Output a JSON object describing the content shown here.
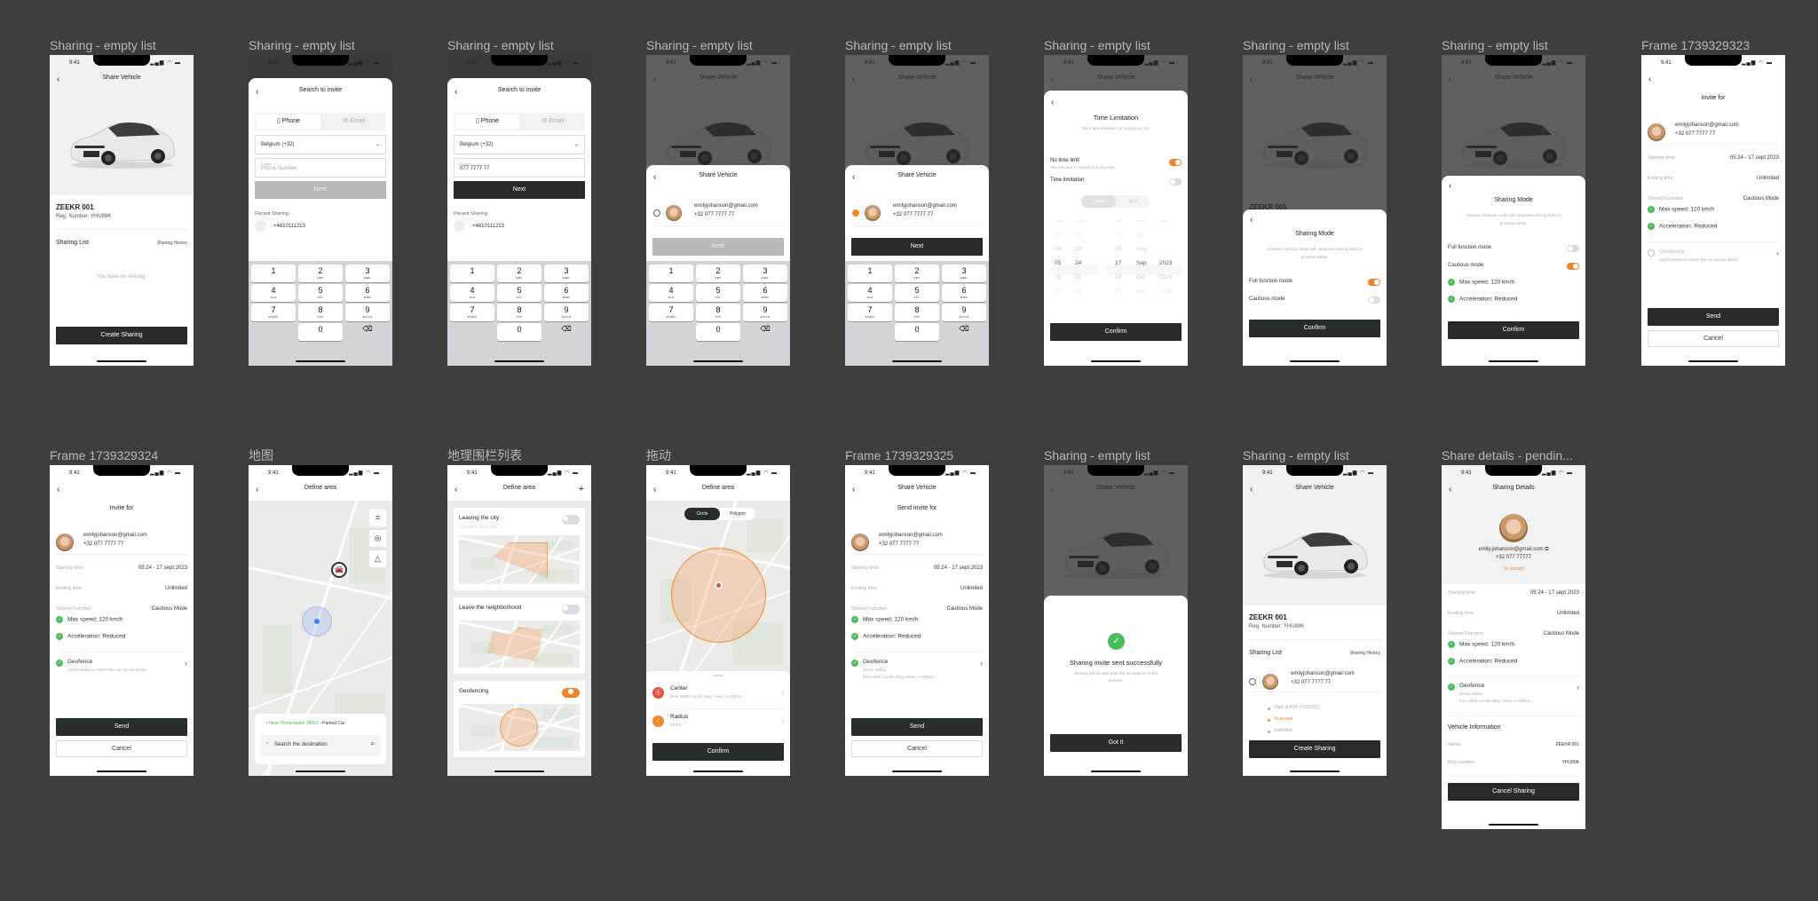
{
  "canvas": {
    "background": "#3e3e3e"
  },
  "colors": {
    "accent": "#f0822a",
    "dark_button": "#262b2c",
    "success": "#4cbb5a",
    "disabled_button": "#b7b8b8"
  },
  "status_bar": {
    "time": "9:41",
    "icons": "signal-wifi-battery"
  },
  "frames": [
    {
      "title": "Sharing - empty list",
      "header": "Share Vehicle",
      "vehicle_name": "ZEEKR 001",
      "reg_number": "Reg. Number: YHU89K",
      "section_title": "Sharing  List",
      "section_link": "Sharing History",
      "empty_text": "You have no sharing.",
      "button": "Create Sharing"
    },
    {
      "title": "Sharing - empty list",
      "header": "Search to invite",
      "tabs": [
        "Phone",
        "Email"
      ],
      "country": "Belgium (+32)",
      "phone_label": "Phone",
      "phone_placeholder": "Phone Number",
      "button": "Next",
      "recent_title": "Recent Sharing",
      "recent_item": "+4610111213"
    },
    {
      "title": "Sharing - empty list",
      "header": "Search to invite",
      "tabs": [
        "Phone",
        "Email"
      ],
      "country": "Belgium (+32)",
      "phone_label": "Phone",
      "phone_value": "077 7777 77",
      "button": "Next",
      "recent_title": "Recent Sharing",
      "recent_item": "+4610111213"
    },
    {
      "title": "Sharing - empty list",
      "background_header": "Share Vehicle",
      "header": "Share Vehicle",
      "email": "emilyjohanson@gmail.com",
      "phone": "+32 077 7777 77",
      "selected": false,
      "button": "Next"
    },
    {
      "title": "Sharing - empty list",
      "background_header": "Share Vehicle",
      "header": "Share Vehicle",
      "email": "emilyjohanson@gmail.com",
      "phone": "+32 077 7777 77",
      "selected": true,
      "button": "Next"
    },
    {
      "title": "Sharing - empty list",
      "background_header": "Share Vehicle",
      "header": "Time Limitation",
      "subtitle": "Set a time limitation for using your car.",
      "option1": "No time limit",
      "option1_sub": "You can end or change it at any time",
      "option1_on": true,
      "option2": "Time limitation",
      "option2_on": false,
      "seg": [
        "Start",
        "End"
      ],
      "picker_headers": [
        "Hours",
        "Minutes",
        "Days",
        "Months",
        "Years"
      ],
      "hours": [
        "03",
        "04",
        "05",
        "06",
        "07"
      ],
      "minutes": [
        "22",
        "23",
        "24",
        "25",
        "26"
      ],
      "days": [
        "15",
        "16",
        "17",
        "18",
        "19"
      ],
      "months": [
        "Jul",
        "Aug",
        "Sep",
        "Oct",
        "Nov"
      ],
      "years": [
        "",
        "",
        "2023",
        "2024",
        "2025"
      ],
      "button": "Confirm"
    },
    {
      "title": "Sharing - empty list",
      "background_header": "Share Vehicle",
      "background_vehicle": "ZEEKR 001",
      "header": "Sharing Mode",
      "subtitle": "Activate Cautious mode will customize driving limits to promote safety.",
      "mode1": "Full function mode",
      "mode1_on": true,
      "mode2": "Cautious mode",
      "mode2_on": false,
      "button": "Confirm"
    },
    {
      "title": "Sharing - empty list",
      "background_header": "Share Vehicle",
      "header": "Sharing Mode",
      "subtitle": "Activate Cautious mode will customize driving limits to promote safety.",
      "mode1": "Full function mode",
      "mode1_on": false,
      "mode2": "Cautious mode",
      "mode2_on": true,
      "features": [
        "Max speed: 120 km/h",
        "Acceleration: Reduced"
      ],
      "button": "Confirm"
    },
    {
      "title": "Frame 1739329323",
      "header": "Invite for",
      "email": "emilyjohanson@gmail.com",
      "phone": "+32 077 7777 77",
      "rows": [
        {
          "k": "Starting time",
          "v": "05:24 - 17 sept 2023"
        },
        {
          "k": "Ending time",
          "v": "Unlimited"
        },
        {
          "k": "Shared Function",
          "v": "Cautious Mode"
        }
      ],
      "features": [
        "Max speed: 120 km/h",
        "Acceleration: Reduced"
      ],
      "geofence": "Geofence",
      "geofence_sub": "Add limitation to where the car can be driven",
      "geofence_enabled": false,
      "send": "Send",
      "cancel": "Cancel"
    },
    {
      "title": "Frame 1739329324",
      "header": "Invite for",
      "email": "emilyjohanson@gmail.com",
      "phone": "+32 077 7777 77",
      "rows": [
        {
          "k": "Starting time",
          "v": "05:24 - 17 sept 2023"
        },
        {
          "k": "Ending time",
          "v": "Unlimited"
        },
        {
          "k": "Shared Function",
          "v": "Cautious Mode"
        }
      ],
      "features": [
        "Max speed: 120 km/h",
        "Acceleration: Reduced"
      ],
      "geofence": "Geofence",
      "geofence_sub": "Add limitation to where the car can be driven",
      "geofence_enabled": true,
      "send": "Send",
      "cancel": "Cancel"
    },
    {
      "title": "地图",
      "header": "Define area",
      "location_text": "Near Olympiapark 18052",
      "location_suffix": " - Parked Car",
      "search_placeholder": "Search the destination",
      "map_tools": [
        "grid-icon",
        "locate-icon",
        "navigate-icon"
      ]
    },
    {
      "title": "地理围栏列表",
      "header": "Define area",
      "areas": [
        {
          "name": "Leaving the city",
          "date": "27/08/2023 - 27/08/2023",
          "on": false,
          "shape": "polygon"
        },
        {
          "name": "Leave the neighborhood",
          "date": "",
          "on": false,
          "shape": "polygon"
        },
        {
          "name": "Geofencing",
          "date": "",
          "on": true,
          "shape": "circle"
        }
      ]
    },
    {
      "title": "拖动",
      "header": "Define area",
      "seg": [
        "Circle",
        "Polygon"
      ],
      "center_label": "Center",
      "center_value": "Near 3800 Lincoln Way, Ames, IA 50014...",
      "radius_label": "Radius",
      "radius_value": "10 km",
      "button": "Confirm"
    },
    {
      "title": "Frame 1739329325",
      "header": "Share Vehicle",
      "subheader": "Send invite for",
      "email": "emilyjohanson@gmail.com",
      "phone": "+32 077 7777 77",
      "rows": [
        {
          "k": "Starting time",
          "v": "05:24 - 17 sept 2023"
        },
        {
          "k": "Ending time",
          "v": "Unlimited"
        },
        {
          "k": "Shared Function",
          "v": "Cautious Mode"
        }
      ],
      "features": [
        "Max speed: 120 km/h",
        "Acceleration: Reduced"
      ],
      "geofence": "Geofence",
      "geofence_sub1": "10 km radius",
      "geofence_sub2": "from 3800 Lincoln Way, Ames, IA 50014...",
      "send": "Send",
      "cancel": "Cancel"
    },
    {
      "title": "Sharing - empty list",
      "background_header": "Share Vehicle",
      "success_title": "Sharing invite sent successfully",
      "success_sub": "Sharing will be valid after the acceptance of the receiver.",
      "button": "Got it"
    },
    {
      "title": "Sharing - empty list",
      "header": "Share Vehicle",
      "vehicle_name": "ZEEKR 001",
      "reg_number": "Reg. Number: YHU89K",
      "section_title": "Sharing  List",
      "section_link": "Sharing History",
      "email": "emilyjohanson@gmail.com",
      "phone": "+32 077 7777 77",
      "timeline": [
        "Start at 8:00 27/3/2023",
        "To accept",
        "Unlimited"
      ],
      "button": "Create Sharing"
    },
    {
      "title": "Share details - pendin...",
      "header": "Sharing Details",
      "email": "emily.johanson@gmail.com",
      "phone": "+32 077 77777",
      "status": "To accept",
      "rows": [
        {
          "k": "Starting time",
          "v": "05:24 - 17 sept 2023"
        },
        {
          "k": "Ending time",
          "v": "Unlimited"
        },
        {
          "k": "Shared Function",
          "v": "Cautious Mode"
        }
      ],
      "features": [
        "Max speed: 120 km/h",
        "Acceleration: Reduced"
      ],
      "geofence": "Geofence",
      "geofence_sub1": "10 km radius",
      "geofence_sub2": "from 3800 Lincoln Way, Ames, IA 50014...",
      "vehicle_info_title": "Vehicle Information",
      "vehicle_rows": [
        {
          "k": "Name",
          "v": "ZEEKR 001"
        },
        {
          "k": "Reg number",
          "v": "YHU89K"
        }
      ],
      "button": "Cancel Sharing"
    }
  ],
  "keypad": [
    {
      "n": "1",
      "l": ""
    },
    {
      "n": "2",
      "l": "ABC"
    },
    {
      "n": "3",
      "l": "DEF"
    },
    {
      "n": "4",
      "l": "GHI"
    },
    {
      "n": "5",
      "l": "JKL"
    },
    {
      "n": "6",
      "l": "MNO"
    },
    {
      "n": "7",
      "l": "PQRS"
    },
    {
      "n": "8",
      "l": "TUV"
    },
    {
      "n": "9",
      "l": "WXYZ"
    },
    {
      "n": "",
      "l": ""
    },
    {
      "n": "0",
      "l": ""
    },
    {
      "n": "⌫",
      "l": ""
    }
  ]
}
